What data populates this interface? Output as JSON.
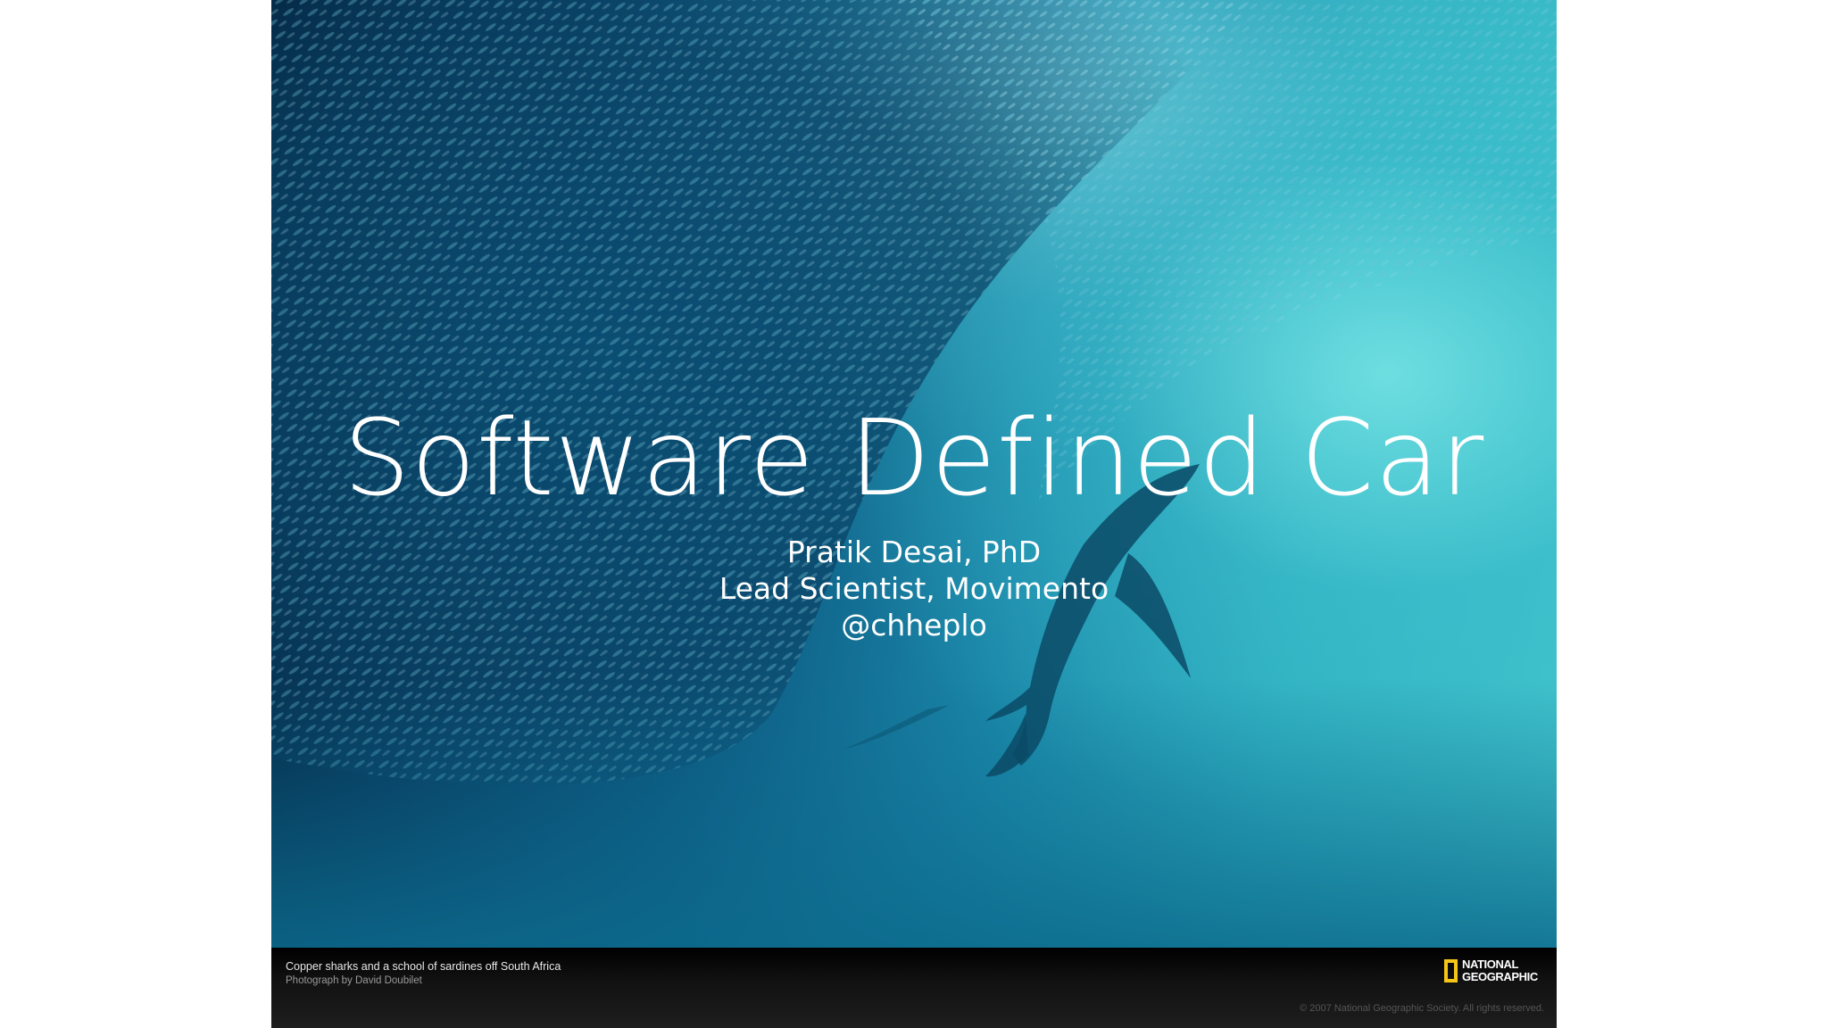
{
  "slide": {
    "title": "Software Defined Car",
    "subtitle_lines": [
      "Pratik Desai, PhD",
      "Lead Scientist, Movimento",
      "@chheplo"
    ]
  },
  "photo_credit": {
    "caption": "Copper sharks and a school of sardines off South Africa",
    "photographer": "Photograph by David Doubilet",
    "logo_line1": "NATIONAL",
    "logo_line2": "GEOGRAPHIC",
    "copyright": "© 2007 National Geographic Society. All rights reserved."
  },
  "colors": {
    "page_background": "#ffffff",
    "water_deep": "#03203a",
    "water_light": "#43c6cc",
    "logo_yellow": "#f5c518",
    "text": "#ffffff"
  }
}
